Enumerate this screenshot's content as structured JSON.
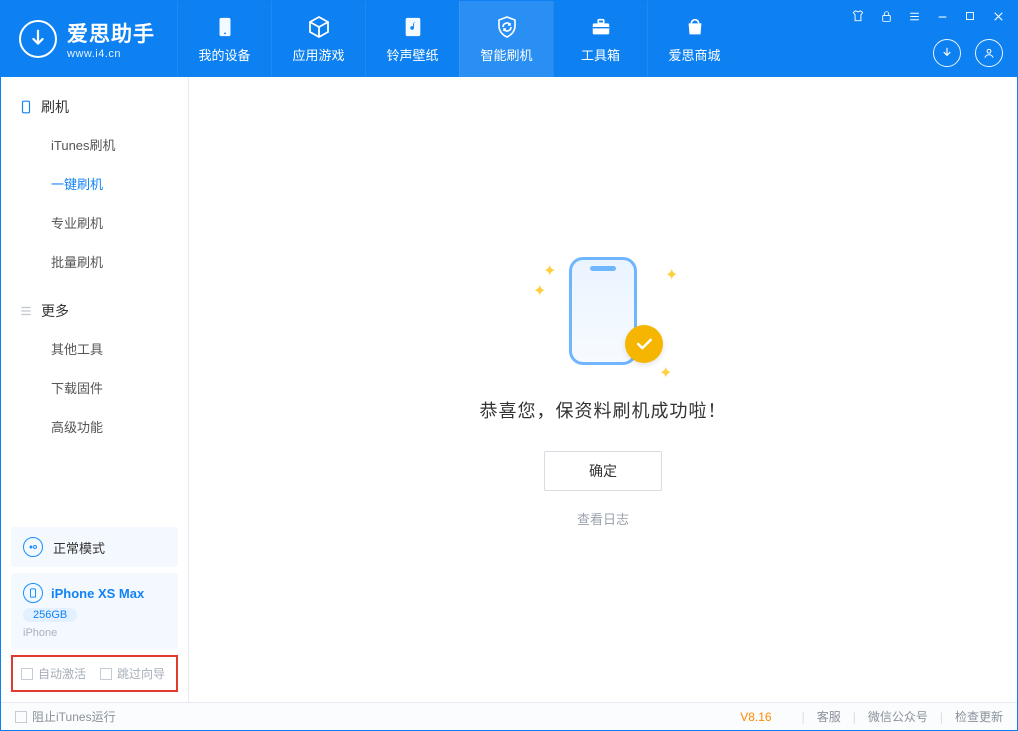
{
  "app": {
    "name": "爱思助手",
    "url": "www.i4.cn"
  },
  "tabs": [
    {
      "id": "device",
      "label": "我的设备",
      "icon": "device-icon"
    },
    {
      "id": "apps",
      "label": "应用游戏",
      "icon": "cube-icon"
    },
    {
      "id": "rings",
      "label": "铃声壁纸",
      "icon": "music-file-icon"
    },
    {
      "id": "flash",
      "label": "智能刷机",
      "icon": "refresh-shield-icon",
      "active": true
    },
    {
      "id": "toolbox",
      "label": "工具箱",
      "icon": "toolbox-icon"
    },
    {
      "id": "store",
      "label": "爱思商城",
      "icon": "bag-icon"
    }
  ],
  "sidebar": {
    "sections": [
      {
        "title": "刷机",
        "icon": "phone-outline-icon",
        "items": [
          {
            "id": "itunes",
            "label": "iTunes刷机"
          },
          {
            "id": "oneclick",
            "label": "一键刷机",
            "active": true
          },
          {
            "id": "pro",
            "label": "专业刷机"
          },
          {
            "id": "batch",
            "label": "批量刷机"
          }
        ]
      },
      {
        "title": "更多",
        "icon": "list-icon",
        "items": [
          {
            "id": "othertools",
            "label": "其他工具"
          },
          {
            "id": "firmware",
            "label": "下载固件"
          },
          {
            "id": "advanced",
            "label": "高级功能"
          }
        ]
      }
    ],
    "mode": {
      "label": "正常模式"
    },
    "device": {
      "name": "iPhone XS Max",
      "storage": "256GB",
      "type": "iPhone"
    },
    "options": {
      "auto_activate": "自动激活",
      "skip_wizard": "跳过向导"
    }
  },
  "main": {
    "message": "恭喜您，保资料刷机成功啦！",
    "ok": "确定",
    "view_log": "查看日志"
  },
  "statusbar": {
    "block_itunes": "阻止iTunes运行",
    "version": "V8.16",
    "links": [
      "客服",
      "微信公众号",
      "检查更新"
    ]
  }
}
